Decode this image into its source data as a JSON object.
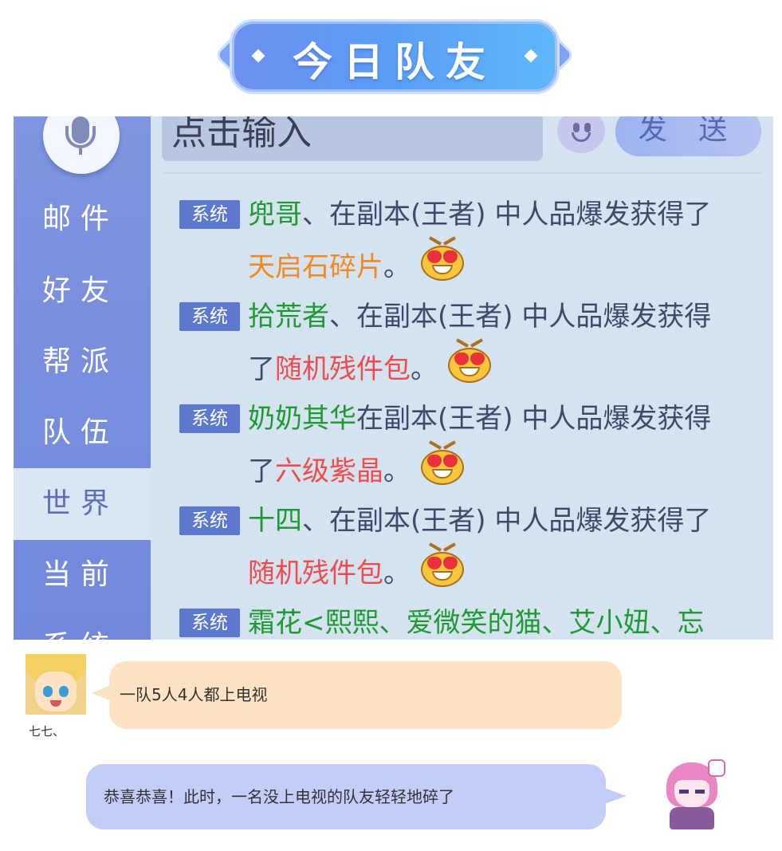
{
  "banner": {
    "title": "今日队友"
  },
  "game": {
    "input_placeholder": "点击输入",
    "send_label": "发 送",
    "sidebar": [
      {
        "label": "邮件",
        "active": false
      },
      {
        "label": "好友",
        "active": false
      },
      {
        "label": "帮派",
        "active": false
      },
      {
        "label": "队伍",
        "active": false
      },
      {
        "label": "世界",
        "active": true
      },
      {
        "label": "当前",
        "active": false
      },
      {
        "label": "系统",
        "active": false
      }
    ],
    "messages": [
      {
        "tag": "系统",
        "name": "兜哥",
        "text": "、在副本(王者) 中人品爆发获得了",
        "item": "天启石碎片",
        "item_color": "orange",
        "end": "。"
      },
      {
        "tag": "系统",
        "name": "拾荒者",
        "text": "、在副本(王者) 中人品爆发获得",
        "text2": "了",
        "item": "随机残件包",
        "item_color": "red",
        "end": "。"
      },
      {
        "tag": "系统",
        "name": "奶奶其华",
        "text": "在副本(王者) 中人品爆发获得",
        "text2": "了",
        "item": "六级紫晶",
        "item_color": "red",
        "end": "。"
      },
      {
        "tag": "系统",
        "name": "十四",
        "text": "、在副本(王者) 中人品爆发获得了",
        "item": "随机残件包",
        "item_color": "red",
        "end": "。"
      },
      {
        "tag": "系统",
        "name": "霜花<熙熙、爱微笑的猫、艾小妞、忘",
        "text": "",
        "item": "",
        "end": ""
      }
    ]
  },
  "chat": [
    {
      "speaker": "七七、",
      "text": "一队5人4人都上电视",
      "side": "left"
    },
    {
      "speaker": "",
      "text": "恭喜恭喜！此时，一名没上电视的队友轻轻地碎了",
      "side": "right"
    }
  ]
}
